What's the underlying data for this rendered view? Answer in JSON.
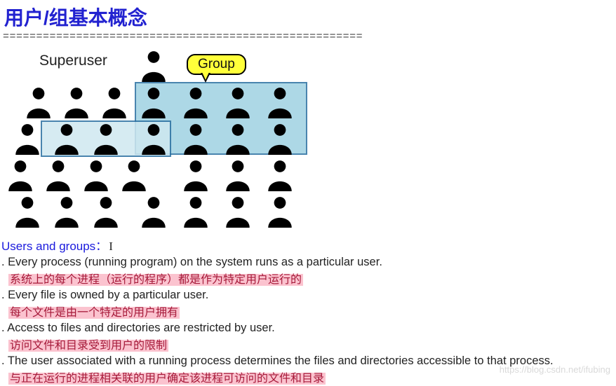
{
  "title": "用户/组基本概念",
  "divider": "======================================================",
  "diagram": {
    "superuser_label": "Superuser",
    "group_label": "Group"
  },
  "section_heading": "Users and groups：",
  "cursor_char": "I",
  "points": [
    {
      "en": ". Every process (running program) on the system runs as a particular user.",
      "cn": "系统上的每个进程（运行的程序）都是作为特定用户运行的"
    },
    {
      "en": ". Every file is owned by a particular user.",
      "cn": "每个文件是由一个特定的用户拥有"
    },
    {
      "en": ". Access to files and directories are restricted by user.",
      "cn": "访问文件和目录受到用户的限制"
    },
    {
      "en": ". The user associated with a running process determines the files and directories accessible to that process.",
      "cn": "与正在运行的进程相关联的用户确定该进程可访问的文件和目录"
    }
  ],
  "watermark": "https://blog.csdn.net/ifubing"
}
